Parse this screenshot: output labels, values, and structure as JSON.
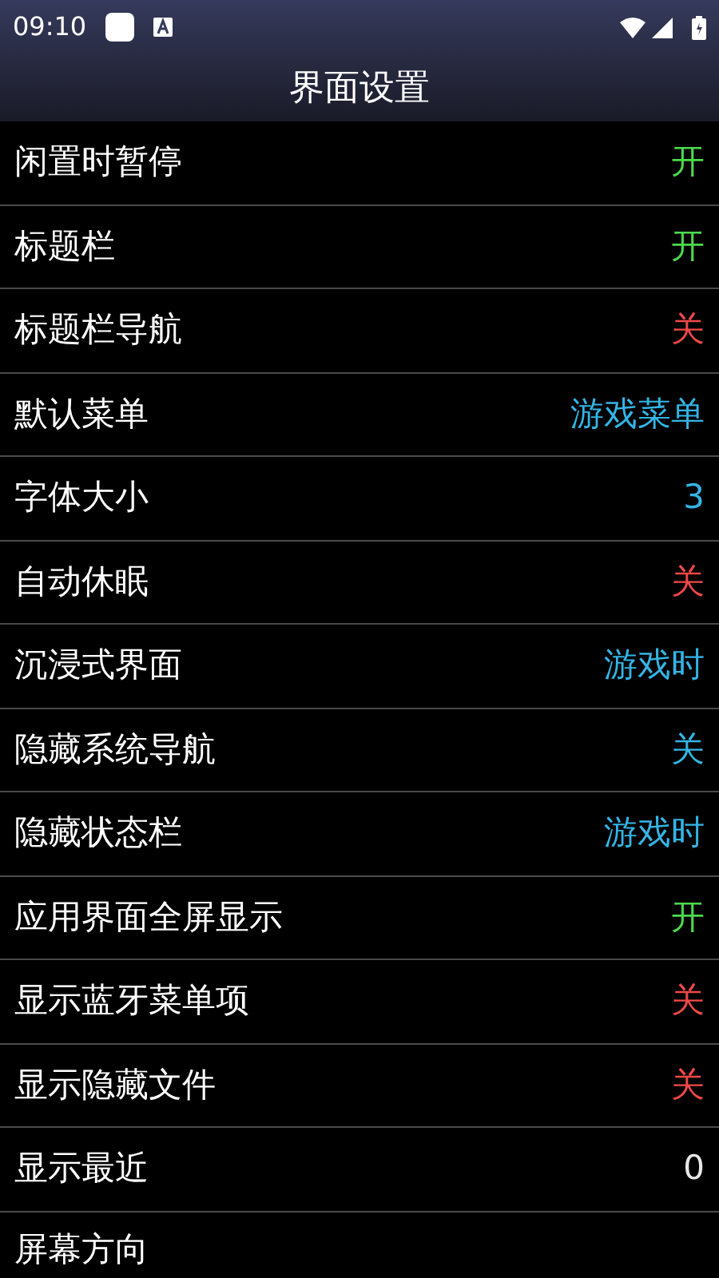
{
  "status_bar": {
    "time": "09:10"
  },
  "title": "界面设置",
  "settings": [
    {
      "label": "闲置时暂停",
      "value": "开",
      "color": "#4cd94c"
    },
    {
      "label": "标题栏",
      "value": "开",
      "color": "#4cd94c"
    },
    {
      "label": "标题栏导航",
      "value": "关",
      "color": "#f04848"
    },
    {
      "label": "默认菜单",
      "value": "游戏菜单",
      "color": "#33b5e5"
    },
    {
      "label": "字体大小",
      "value": "3",
      "color": "#33b5e5"
    },
    {
      "label": "自动休眠",
      "value": "关",
      "color": "#f04848"
    },
    {
      "label": "沉浸式界面",
      "value": "游戏时",
      "color": "#33b5e5"
    },
    {
      "label": "隐藏系统导航",
      "value": "关",
      "color": "#33b5e5"
    },
    {
      "label": "隐藏状态栏",
      "value": "游戏时",
      "color": "#33b5e5"
    },
    {
      "label": "应用界面全屏显示",
      "value": "开",
      "color": "#4cd94c"
    },
    {
      "label": "显示蓝牙菜单项",
      "value": "关",
      "color": "#f04848"
    },
    {
      "label": "显示隐藏文件",
      "value": "关",
      "color": "#f04848"
    },
    {
      "label": "显示最近",
      "value": "0",
      "color": "#e8e8e8"
    }
  ],
  "section": {
    "label": "屏幕方向"
  }
}
